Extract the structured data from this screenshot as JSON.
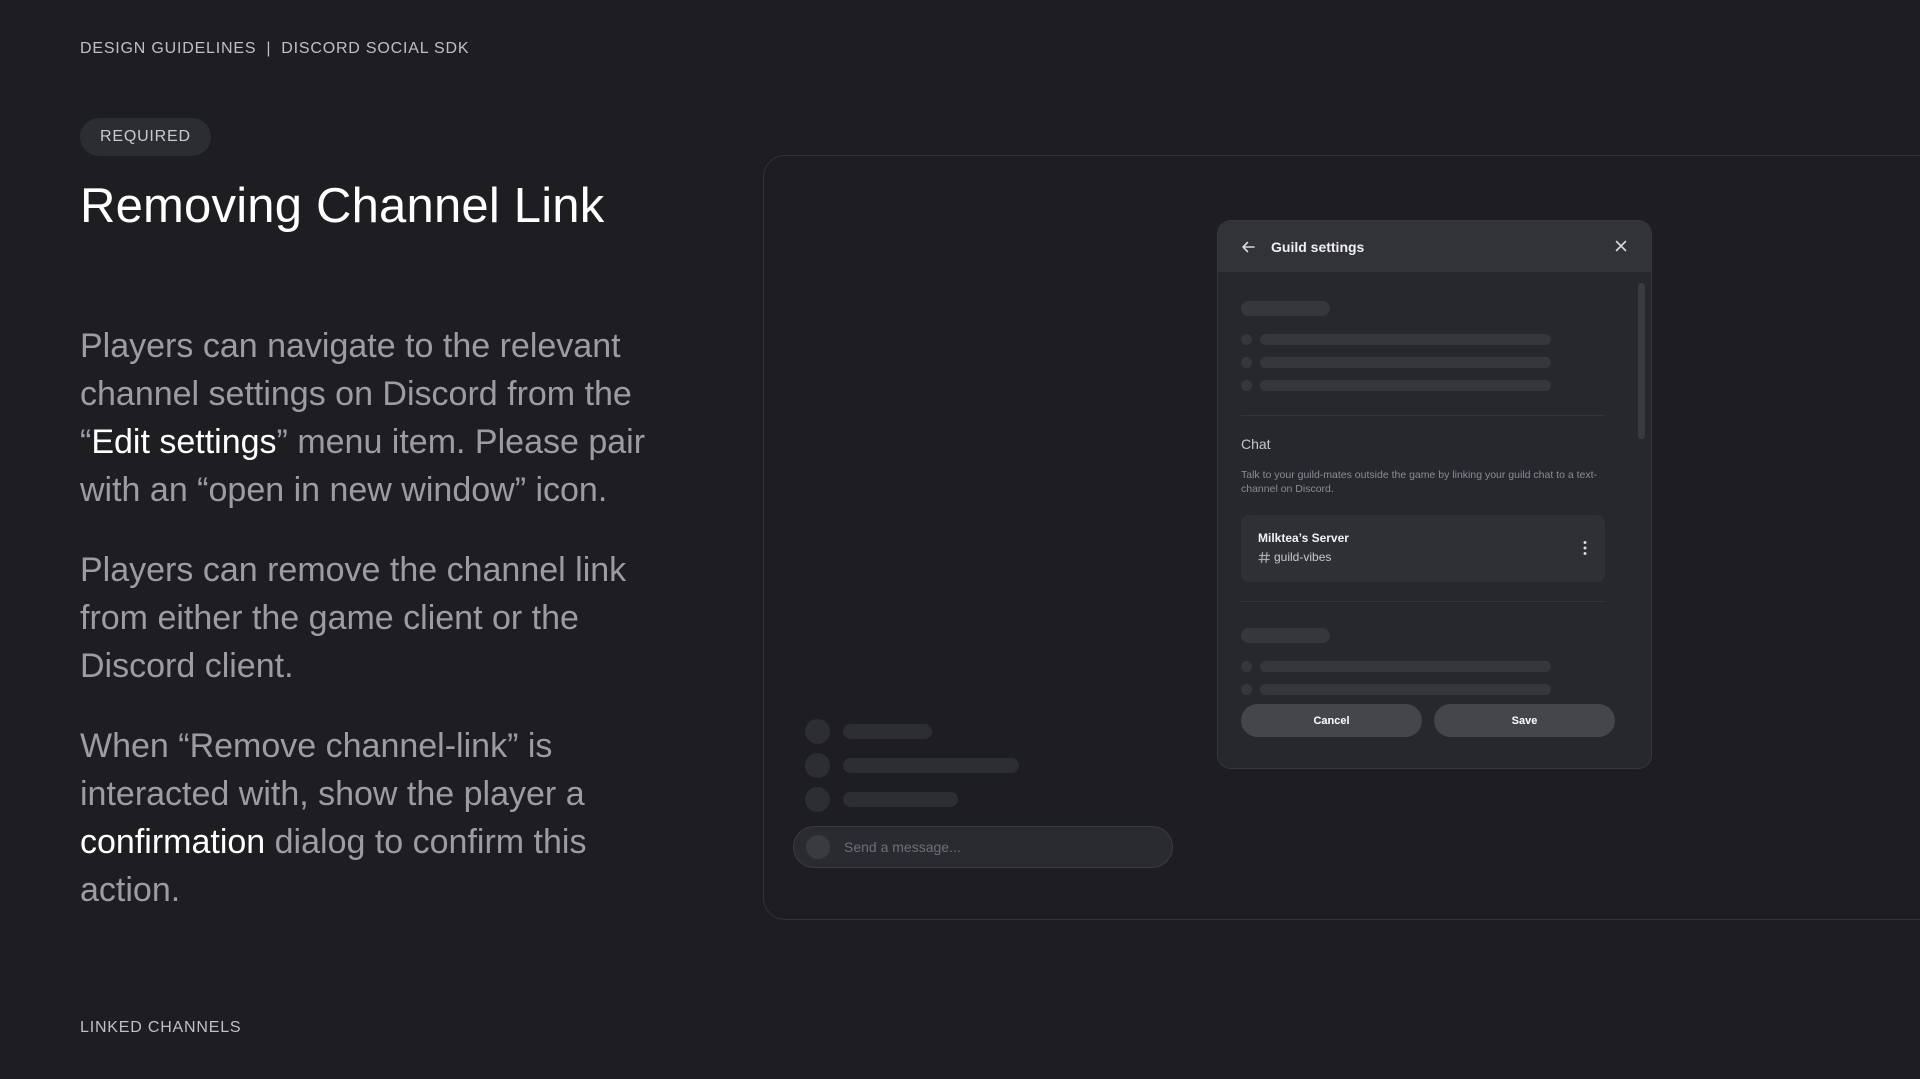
{
  "header": {
    "breadcrumb_left": "DESIGN GUIDELINES",
    "separator": "|",
    "breadcrumb_right": "DISCORD SOCIAL SDK"
  },
  "tag": "REQUIRED",
  "title": "Removing Channel Link",
  "paragraphs": {
    "p1": {
      "a": "Players can navigate to the relevant channel settings on Discord from the “",
      "em": "Edit settings",
      "b": "” menu item. Please pair with an “open in new window” icon."
    },
    "p2": "Players can remove the channel link from either the game client or the Discord client.",
    "p3": {
      "a": "When “Remove channel-link” is interacted with, show the player a ",
      "em": "confirmation",
      "b": " dialog to confirm this action."
    }
  },
  "footer_label": "LINKED CHANNELS",
  "mock": {
    "message_placeholder": "Send a message...",
    "dialog": {
      "title": "Guild settings",
      "back_icon": "arrow-left-icon",
      "close_icon": "close-icon",
      "chat_heading": "Chat",
      "chat_description": "Talk to your guild-mates outside the game by linking your guild chat to a text-channel on Discord.",
      "server": {
        "name": "Milktea’s Server",
        "channel": "guild-vibes",
        "channel_icon": "text-channel-hash-icon",
        "more_icon": "more-vertical-icon"
      },
      "cancel_label": "Cancel",
      "save_label": "Save"
    }
  },
  "colors": {
    "background": "#1e1e22",
    "dialog_bg": "#27282d",
    "dialog_header": "#323338",
    "button": "#45464c",
    "text_primary": "#ffffff",
    "text_muted": "#9c9ca4"
  }
}
